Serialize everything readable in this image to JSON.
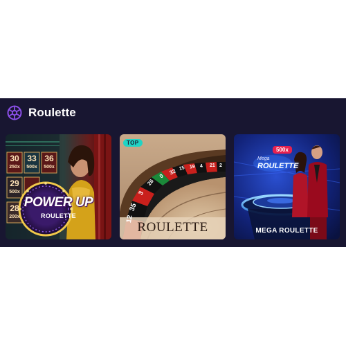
{
  "section": {
    "title": "Roulette",
    "icon": "roulette-wheel-icon"
  },
  "games": [
    {
      "title": "POWER UP",
      "subtitle": "ROULETTE",
      "tiles": [
        {
          "num": "30",
          "mult": "250x"
        },
        {
          "num": "33",
          "mult": "500x"
        },
        {
          "num": "36",
          "mult": "500x"
        },
        {
          "num": "29",
          "mult": "500x"
        },
        {
          "num": "28",
          "mult": "200x"
        }
      ]
    },
    {
      "badge": "TOP",
      "caption": "ROULETTE",
      "wheel_numbers": [
        "12",
        "35",
        "3",
        "26",
        "0",
        "32",
        "15",
        "19",
        "4",
        "21",
        "2"
      ]
    },
    {
      "badge": "500x",
      "logo_small": "Mega",
      "logo": "ROULETTE",
      "caption": "MEGA ROULETTE"
    }
  ],
  "colors": {
    "panel_bg": "#181631",
    "accent_purple": "#8b4fe8",
    "top_badge": "#1fd4c5",
    "multiplier_badge": "#e8214f"
  }
}
